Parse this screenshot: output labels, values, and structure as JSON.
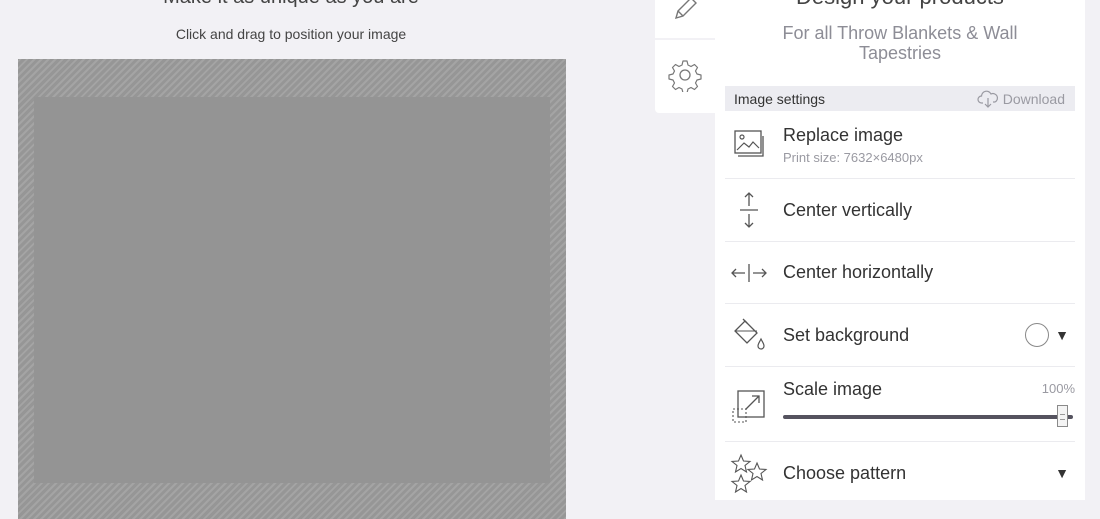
{
  "editor": {
    "heading": "Make it as unique as you are",
    "instructions": "Click and drag to position your image"
  },
  "tabs": [
    {
      "icon": "pencil-icon"
    },
    {
      "icon": "gear-icon"
    }
  ],
  "panel": {
    "title": "Design your products",
    "subtitle": "For all Throw Blankets & Wall Tapestries",
    "settings_bar": {
      "label": "Image settings",
      "download_label": "Download",
      "download_icon": "cloud-download-icon"
    },
    "actions": {
      "replace": {
        "label": "Replace image",
        "sub": "Print size: 7632×6480px",
        "icon": "images-icon"
      },
      "center_v": {
        "label": "Center vertically",
        "icon": "arrows-vertical-icon"
      },
      "center_h": {
        "label": "Center horizontally",
        "icon": "arrows-horizontal-icon"
      },
      "background": {
        "label": "Set background",
        "icon": "paint-bucket-icon",
        "color": "#ffffff"
      },
      "scale": {
        "label": "Scale image",
        "value_label": "100%",
        "value": 100,
        "icon": "scale-icon"
      },
      "pattern": {
        "label": "Choose pattern",
        "icon": "stars-icon"
      }
    }
  },
  "colors": {
    "background": "#f2f1f5",
    "canvas": "#949494",
    "slider_track": "#55535f",
    "muted_text": "#9a9aa2"
  }
}
